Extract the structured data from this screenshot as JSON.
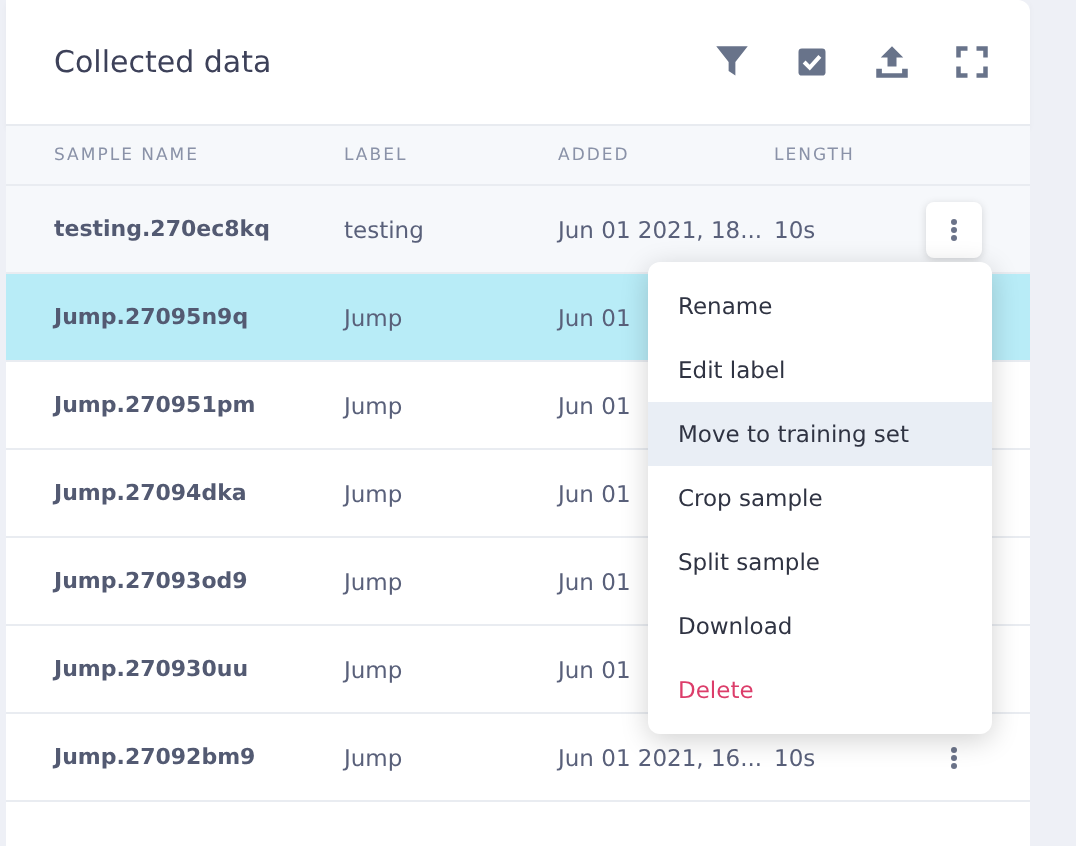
{
  "title": "Collected data",
  "toolbar": [
    {
      "kind": "filter"
    },
    {
      "kind": "select"
    },
    {
      "kind": "upload"
    },
    {
      "kind": "fullscreen"
    }
  ],
  "columns": [
    "SAMPLE NAME",
    "LABEL",
    "ADDED",
    "LENGTH"
  ],
  "rows": [
    {
      "name": "testing.270ec8kq",
      "label": "testing",
      "added": "Jun 01 2021, 18...",
      "length": "10s",
      "selected": false,
      "menu_open": true
    },
    {
      "name": "Jump.27095n9q",
      "label": "Jump",
      "added": "Jun 01",
      "selected": true
    },
    {
      "name": "Jump.270951pm",
      "label": "Jump",
      "added": "Jun 01",
      "selected": false
    },
    {
      "name": "Jump.27094dka",
      "label": "Jump",
      "added": "Jun 01",
      "selected": false
    },
    {
      "name": "Jump.27093od9",
      "label": "Jump",
      "added": "Jun 01",
      "selected": false
    },
    {
      "name": "Jump.270930uu",
      "label": "Jump",
      "added": "Jun 01",
      "selected": false
    },
    {
      "name": "Jump.27092bm9",
      "label": "Jump",
      "added": "Jun 01 2021, 16...",
      "length": "10s",
      "selected": false,
      "menu_open": false
    }
  ],
  "menu": [
    {
      "label": "Rename",
      "kind": "normal",
      "selected": false
    },
    {
      "label": "Edit label",
      "kind": "normal",
      "selected": false
    },
    {
      "label": "Move to training set",
      "kind": "normal",
      "selected": true
    },
    {
      "label": "Crop sample",
      "kind": "normal",
      "selected": false
    },
    {
      "label": "Split sample",
      "kind": "normal",
      "selected": false
    },
    {
      "label": "Download",
      "kind": "normal",
      "selected": false
    },
    {
      "label": "Delete",
      "kind": "danger",
      "selected": false
    }
  ]
}
